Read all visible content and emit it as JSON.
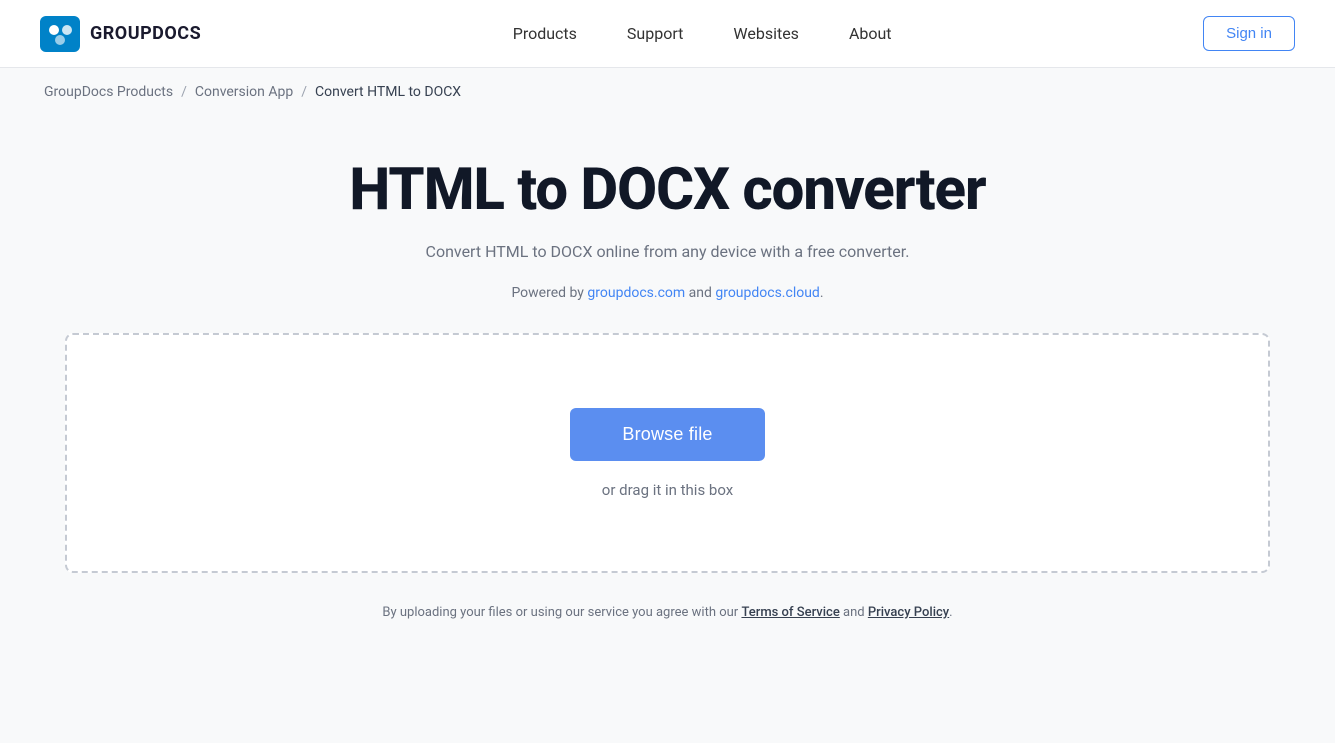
{
  "header": {
    "logo_text": "GROUPDOCS",
    "nav_items": [
      {
        "label": "Products",
        "href": "#"
      },
      {
        "label": "Support",
        "href": "#"
      },
      {
        "label": "Websites",
        "href": "#"
      },
      {
        "label": "About",
        "href": "#"
      }
    ],
    "signin_label": "Sign in"
  },
  "breadcrumb": {
    "items": [
      {
        "label": "GroupDocs Products",
        "href": "#"
      },
      {
        "label": "Conversion App",
        "href": "#"
      },
      {
        "label": "Convert HTML to DOCX",
        "href": "#",
        "current": true
      }
    ],
    "separator": "/"
  },
  "main": {
    "title": "HTML to DOCX converter",
    "subtitle": "Convert HTML to DOCX online from any device with a free converter.",
    "powered_by_prefix": "Powered by ",
    "powered_by_link1_text": "groupdocs.com",
    "powered_by_link1_href": "#",
    "powered_by_between": " and ",
    "powered_by_link2_text": "groupdocs.cloud",
    "powered_by_link2_href": "#",
    "powered_by_suffix": ".",
    "browse_file_label": "Browse file",
    "drag_text": "or drag it in this box"
  },
  "footer_note": {
    "prefix": "By uploading your files or using our service you agree with our ",
    "tos_label": "Terms of Service",
    "between": " and ",
    "privacy_label": "Privacy Policy",
    "suffix": "."
  }
}
